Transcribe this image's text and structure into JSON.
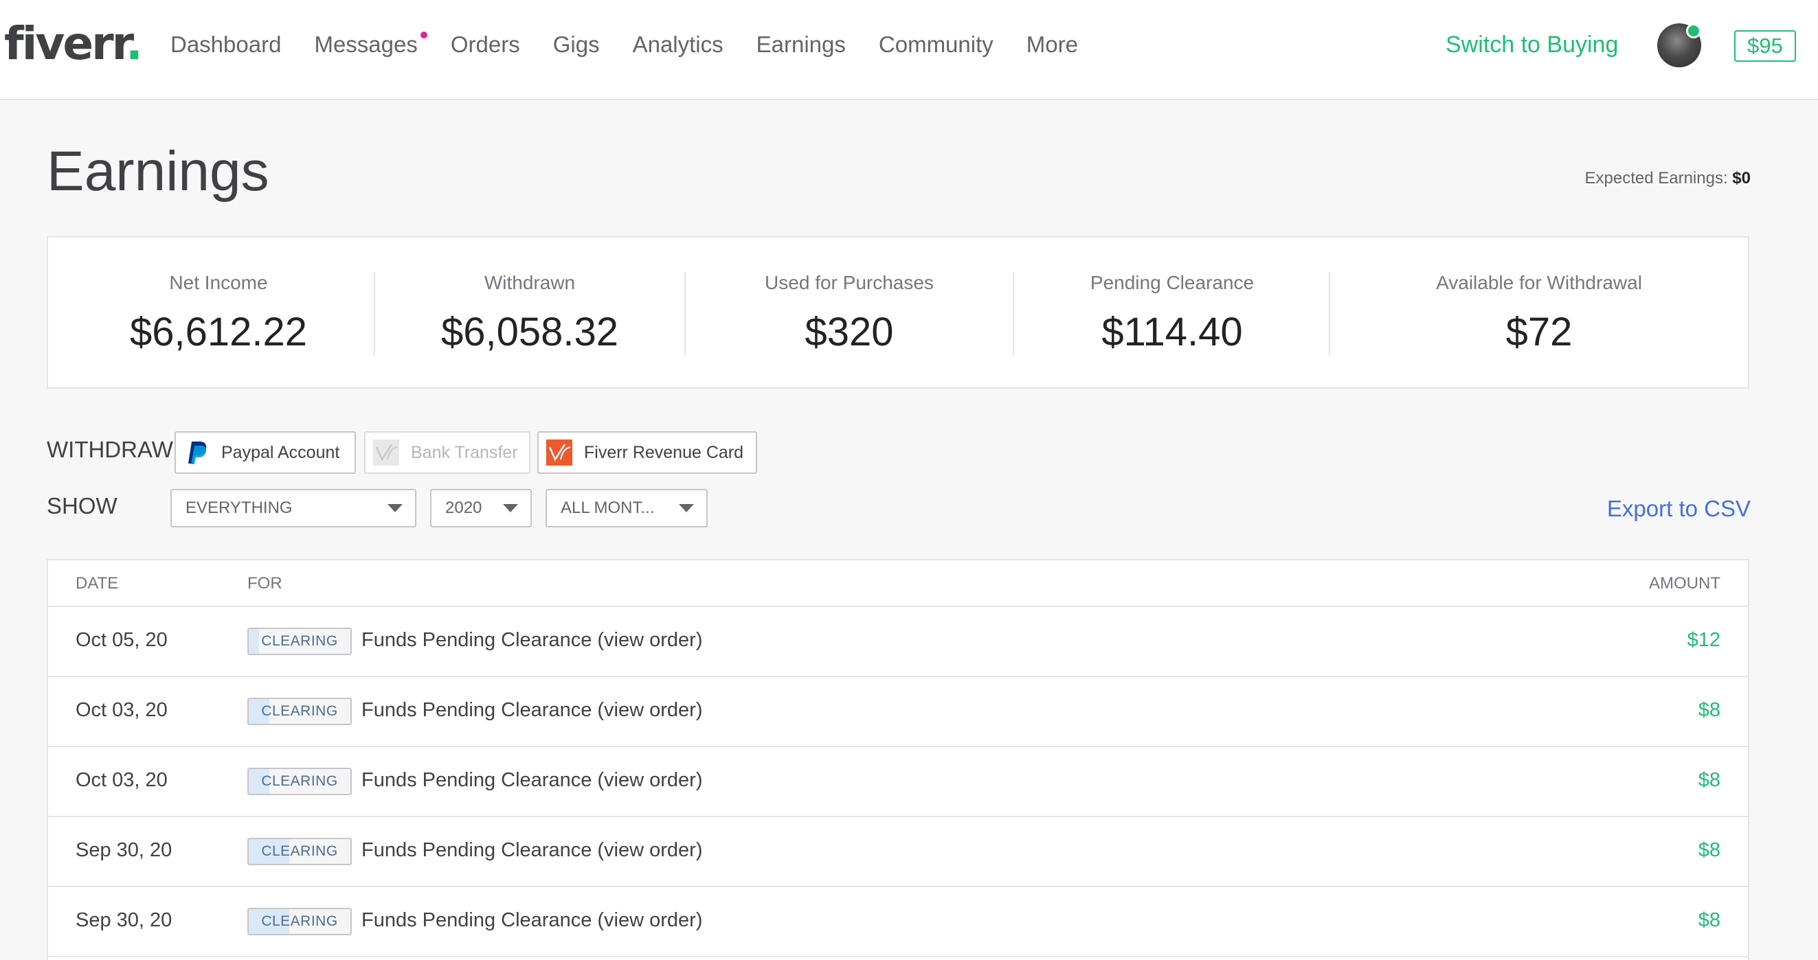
{
  "header": {
    "logo_text": "fiverr",
    "logo_dot": ".",
    "nav": [
      {
        "label": "Dashboard"
      },
      {
        "label": "Messages"
      },
      {
        "label": "Orders"
      },
      {
        "label": "Gigs"
      },
      {
        "label": "Analytics"
      },
      {
        "label": "Earnings"
      },
      {
        "label": "Community"
      },
      {
        "label": "More"
      }
    ],
    "switch_label": "Switch to Buying",
    "balance": "$95"
  },
  "page": {
    "title": "Earnings",
    "expected_label": "Expected Earnings: ",
    "expected_value": "$0"
  },
  "summary": [
    {
      "label": "Net Income",
      "value": "$6,612.22"
    },
    {
      "label": "Withdrawn",
      "value": "$6,058.32"
    },
    {
      "label": "Used for Purchases",
      "value": "$320"
    },
    {
      "label": "Pending Clearance",
      "value": "$114.40"
    },
    {
      "label": "Available for Withdrawal",
      "value": "$72"
    }
  ],
  "withdraw": {
    "label": "WITHDRAW",
    "options": [
      {
        "label": "Paypal Account",
        "icon": "paypal-icon",
        "enabled": true
      },
      {
        "label": "Bank Transfer",
        "icon": "bank-transfer-icon",
        "enabled": false
      },
      {
        "label": "Fiverr Revenue Card",
        "icon": "revenue-card-icon",
        "enabled": true
      }
    ]
  },
  "filters": {
    "label": "SHOW",
    "type_value": "EVERYTHING",
    "year_value": "2020",
    "month_value": "ALL MONT...",
    "export_label": "Export to CSV"
  },
  "table": {
    "headers": {
      "date": "DATE",
      "for": "FOR",
      "amount": "AMOUNT"
    },
    "rows": [
      {
        "date": "Oct 05, 20",
        "status": "CLEARING",
        "progress": 0.1,
        "desc": "Funds Pending Clearance (",
        "link": "view order",
        "desc_end": ")",
        "amount": "$12"
      },
      {
        "date": "Oct 03, 20",
        "status": "CLEARING",
        "progress": 0.2,
        "desc": "Funds Pending Clearance (",
        "link": "view order",
        "desc_end": ")",
        "amount": "$8"
      },
      {
        "date": "Oct 03, 20",
        "status": "CLEARING",
        "progress": 0.2,
        "desc": "Funds Pending Clearance (",
        "link": "view order",
        "desc_end": ")",
        "amount": "$8"
      },
      {
        "date": "Sep 30, 20",
        "status": "CLEARING",
        "progress": 0.4,
        "desc": "Funds Pending Clearance (",
        "link": "view order",
        "desc_end": ")",
        "amount": "$8"
      },
      {
        "date": "Sep 30, 20",
        "status": "CLEARING",
        "progress": 0.4,
        "desc": "Funds Pending Clearance (",
        "link": "view order",
        "desc_end": ")",
        "amount": "$8"
      }
    ]
  },
  "colors": {
    "brand_green": "#1dbf73",
    "link_blue": "#446ee7",
    "notification_dot": "#e0288a",
    "clearing_fill": "#dbe8f7"
  }
}
